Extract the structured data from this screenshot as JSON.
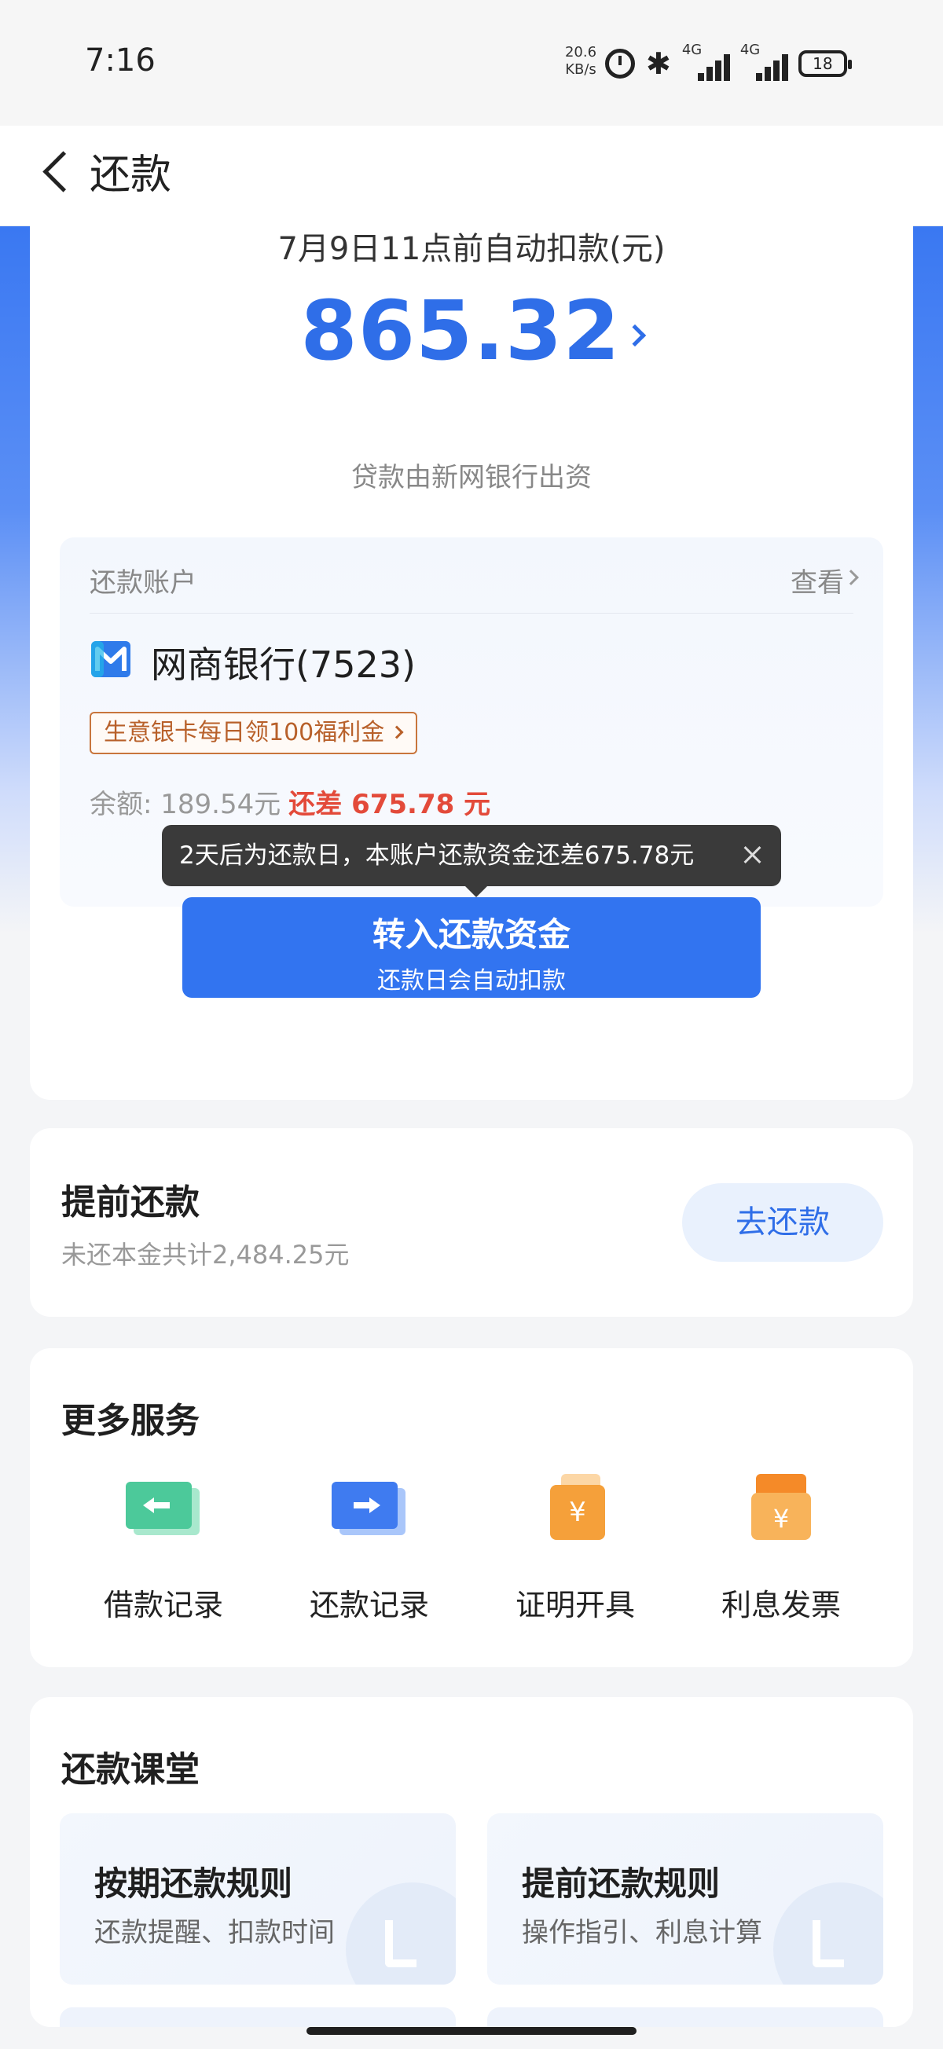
{
  "status_bar": {
    "time": "7:16",
    "net_speed": "20.6",
    "net_unit": "KB/s",
    "signal1_label": "4G",
    "signal2_label": "4G",
    "battery": "18",
    "icons": [
      "alarm-icon",
      "bluetooth-icon",
      "signal-icon",
      "signal-icon",
      "battery-icon"
    ]
  },
  "nav": {
    "title": "还款",
    "back_icon": "back-arrow-icon"
  },
  "due": {
    "label": "7月9日11点前自动扣款(元)",
    "amount": "865.32",
    "lender_note": "贷款由新网银行出资"
  },
  "account": {
    "header": "还款账户",
    "view_label": "查看",
    "bank_name": "网商银行(7523)",
    "promo": "生意银卡每日领100福利金",
    "balance_label": "余额: 189.54元",
    "shortfall": "还差 675.78 元"
  },
  "tooltip": {
    "text": "2天后为还款日，本账户还款资金还差675.78元"
  },
  "primary_button": {
    "title": "转入还款资金",
    "subtitle": "还款日会自动扣款"
  },
  "prepay": {
    "title": "提前还款",
    "subtitle": "未还本金共计2,484.25元",
    "button": "去还款"
  },
  "services": {
    "title": "更多服务",
    "items": [
      {
        "label": "借款记录",
        "icon": "loan-record-icon",
        "color": "#4cc99a"
      },
      {
        "label": "还款记录",
        "icon": "repay-record-icon",
        "color": "#3f7bf0"
      },
      {
        "label": "证明开具",
        "icon": "certificate-icon",
        "color": "#f5a03a"
      },
      {
        "label": "利息发票",
        "icon": "invoice-icon",
        "color": "#f59a32"
      }
    ]
  },
  "classroom": {
    "title": "还款课堂",
    "tiles": [
      {
        "title": "按期还款规则",
        "subtitle": "还款提醒、扣款时间"
      },
      {
        "title": "提前还款规则",
        "subtitle": "操作指引、利息计算"
      }
    ]
  },
  "colors": {
    "accent": "#3274f0",
    "warning": "#e34a3a",
    "promo": "#b8602a"
  }
}
